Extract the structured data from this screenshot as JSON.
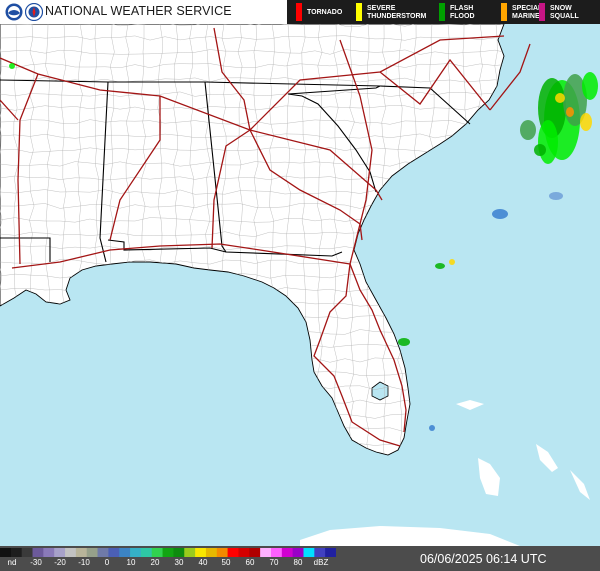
{
  "header": {
    "agency": "NATIONAL WEATHER SERVICE",
    "alerts": [
      {
        "lines": [
          "TORNADO"
        ],
        "color": "#ff0000"
      },
      {
        "lines": [
          "SEVERE",
          "THUNDERSTORM"
        ],
        "color": "#ffff00"
      },
      {
        "lines": [
          "FLASH",
          "FLOOD"
        ],
        "color": "#00a000"
      },
      {
        "lines": [
          "SPECIAL",
          "MARINE"
        ],
        "color": "#ffa500"
      },
      {
        "lines": [
          "SNOW",
          "SQUALL"
        ],
        "color": "#c71585"
      }
    ]
  },
  "map": {
    "colors": {
      "ocean": "#b9e6f2",
      "land": "#ffffff",
      "state_line": "#000000",
      "county_line": "#b0b0b0",
      "highway": "#a31515"
    },
    "radar_colors": [
      "#00ec00",
      "#00b000",
      "#3fa04a",
      "#ffd700",
      "#ff9000",
      "#3a7fd0",
      "#6f9fd8"
    ]
  },
  "legend": {
    "labels": [
      "nd",
      "-30",
      "-20",
      "-10",
      "0",
      "10",
      "20",
      "30",
      "40",
      "50",
      "60",
      "70",
      "80",
      "dBZ"
    ],
    "colors": [
      "#111111",
      "#1e1e1e",
      "#3a3a3a",
      "#6c5a9a",
      "#8a7ab8",
      "#a7a1c9",
      "#c2c2c2",
      "#b8b49a",
      "#96a08a",
      "#6f7aa8",
      "#4b5fb5",
      "#3c84c5",
      "#35b0c6",
      "#2ec7a5",
      "#31d24f",
      "#12a412",
      "#0e8b0e",
      "#9acb1d",
      "#f8e600",
      "#e6b800",
      "#f48a00",
      "#ff0000",
      "#d40000",
      "#b00000",
      "#ffb0ff",
      "#ff60ff",
      "#d000d0",
      "#9a00c8",
      "#00e0ff",
      "#4040c0",
      "#2020a0"
    ],
    "timestamp": "06/06/2025 06:14 UTC"
  }
}
